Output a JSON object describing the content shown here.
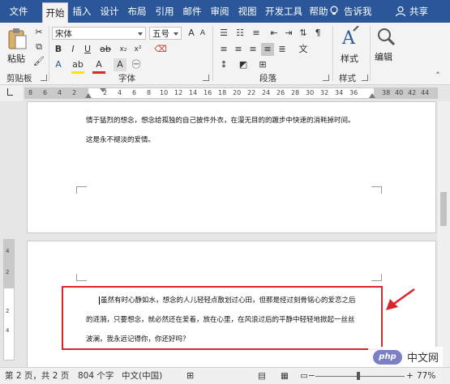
{
  "ribbon_tabs": [
    "文件",
    "开始",
    "插入",
    "设计",
    "布局",
    "引用",
    "邮件",
    "审阅",
    "视图",
    "开发工具",
    "帮助"
  ],
  "tell_me": "告诉我",
  "share": "共享",
  "clipboard": {
    "paste_label": "粘贴",
    "group_label": "剪贴板"
  },
  "font": {
    "name": "宋体",
    "size": "五号",
    "group_label": "字体"
  },
  "paragraph": {
    "group_label": "段落"
  },
  "styles": {
    "label": "样式",
    "group_label": "样式"
  },
  "editing": {
    "label": "编辑"
  },
  "ruler": {
    "h_ticks": [
      "8",
      "6",
      "4",
      "2",
      "2",
      "4",
      "6",
      "8",
      "10",
      "12",
      "14",
      "16",
      "18",
      "20",
      "22",
      "24",
      "26",
      "28",
      "30",
      "32",
      "34",
      "36",
      "38",
      "40",
      "42",
      "44",
      "46",
      "48"
    ],
    "v_ticks": [
      "4",
      "2",
      "2",
      "4"
    ]
  },
  "page1": {
    "line1": "情于猛烈的想念，想念给孤独的自己披件外衣，在漫无目的的踱步中快速的消耗掉时间。",
    "line2": "这是永不褪淡的爱情。"
  },
  "page2": {
    "line1": "虽然有时心静如水，想念的人儿轻轻点散划过心田，但那是经过刻骨铭心的爱恋之后",
    "line2": "的涟漪，只要想念，就必然还在爱着，放在心里，在风浪过后的平静中轻轻地掀起一丝丝",
    "line3": "波澜，我永远记得你，你还好吗？"
  },
  "status": {
    "page": "第 2 页，共 2 页",
    "words": "804 个字",
    "lang": "中文(中国)",
    "zoom": "77%"
  },
  "watermark": {
    "logo": "php",
    "text": "中文网"
  },
  "colors": {
    "tab_blue": "#2b579a",
    "highlight_red": "#d9262b"
  }
}
